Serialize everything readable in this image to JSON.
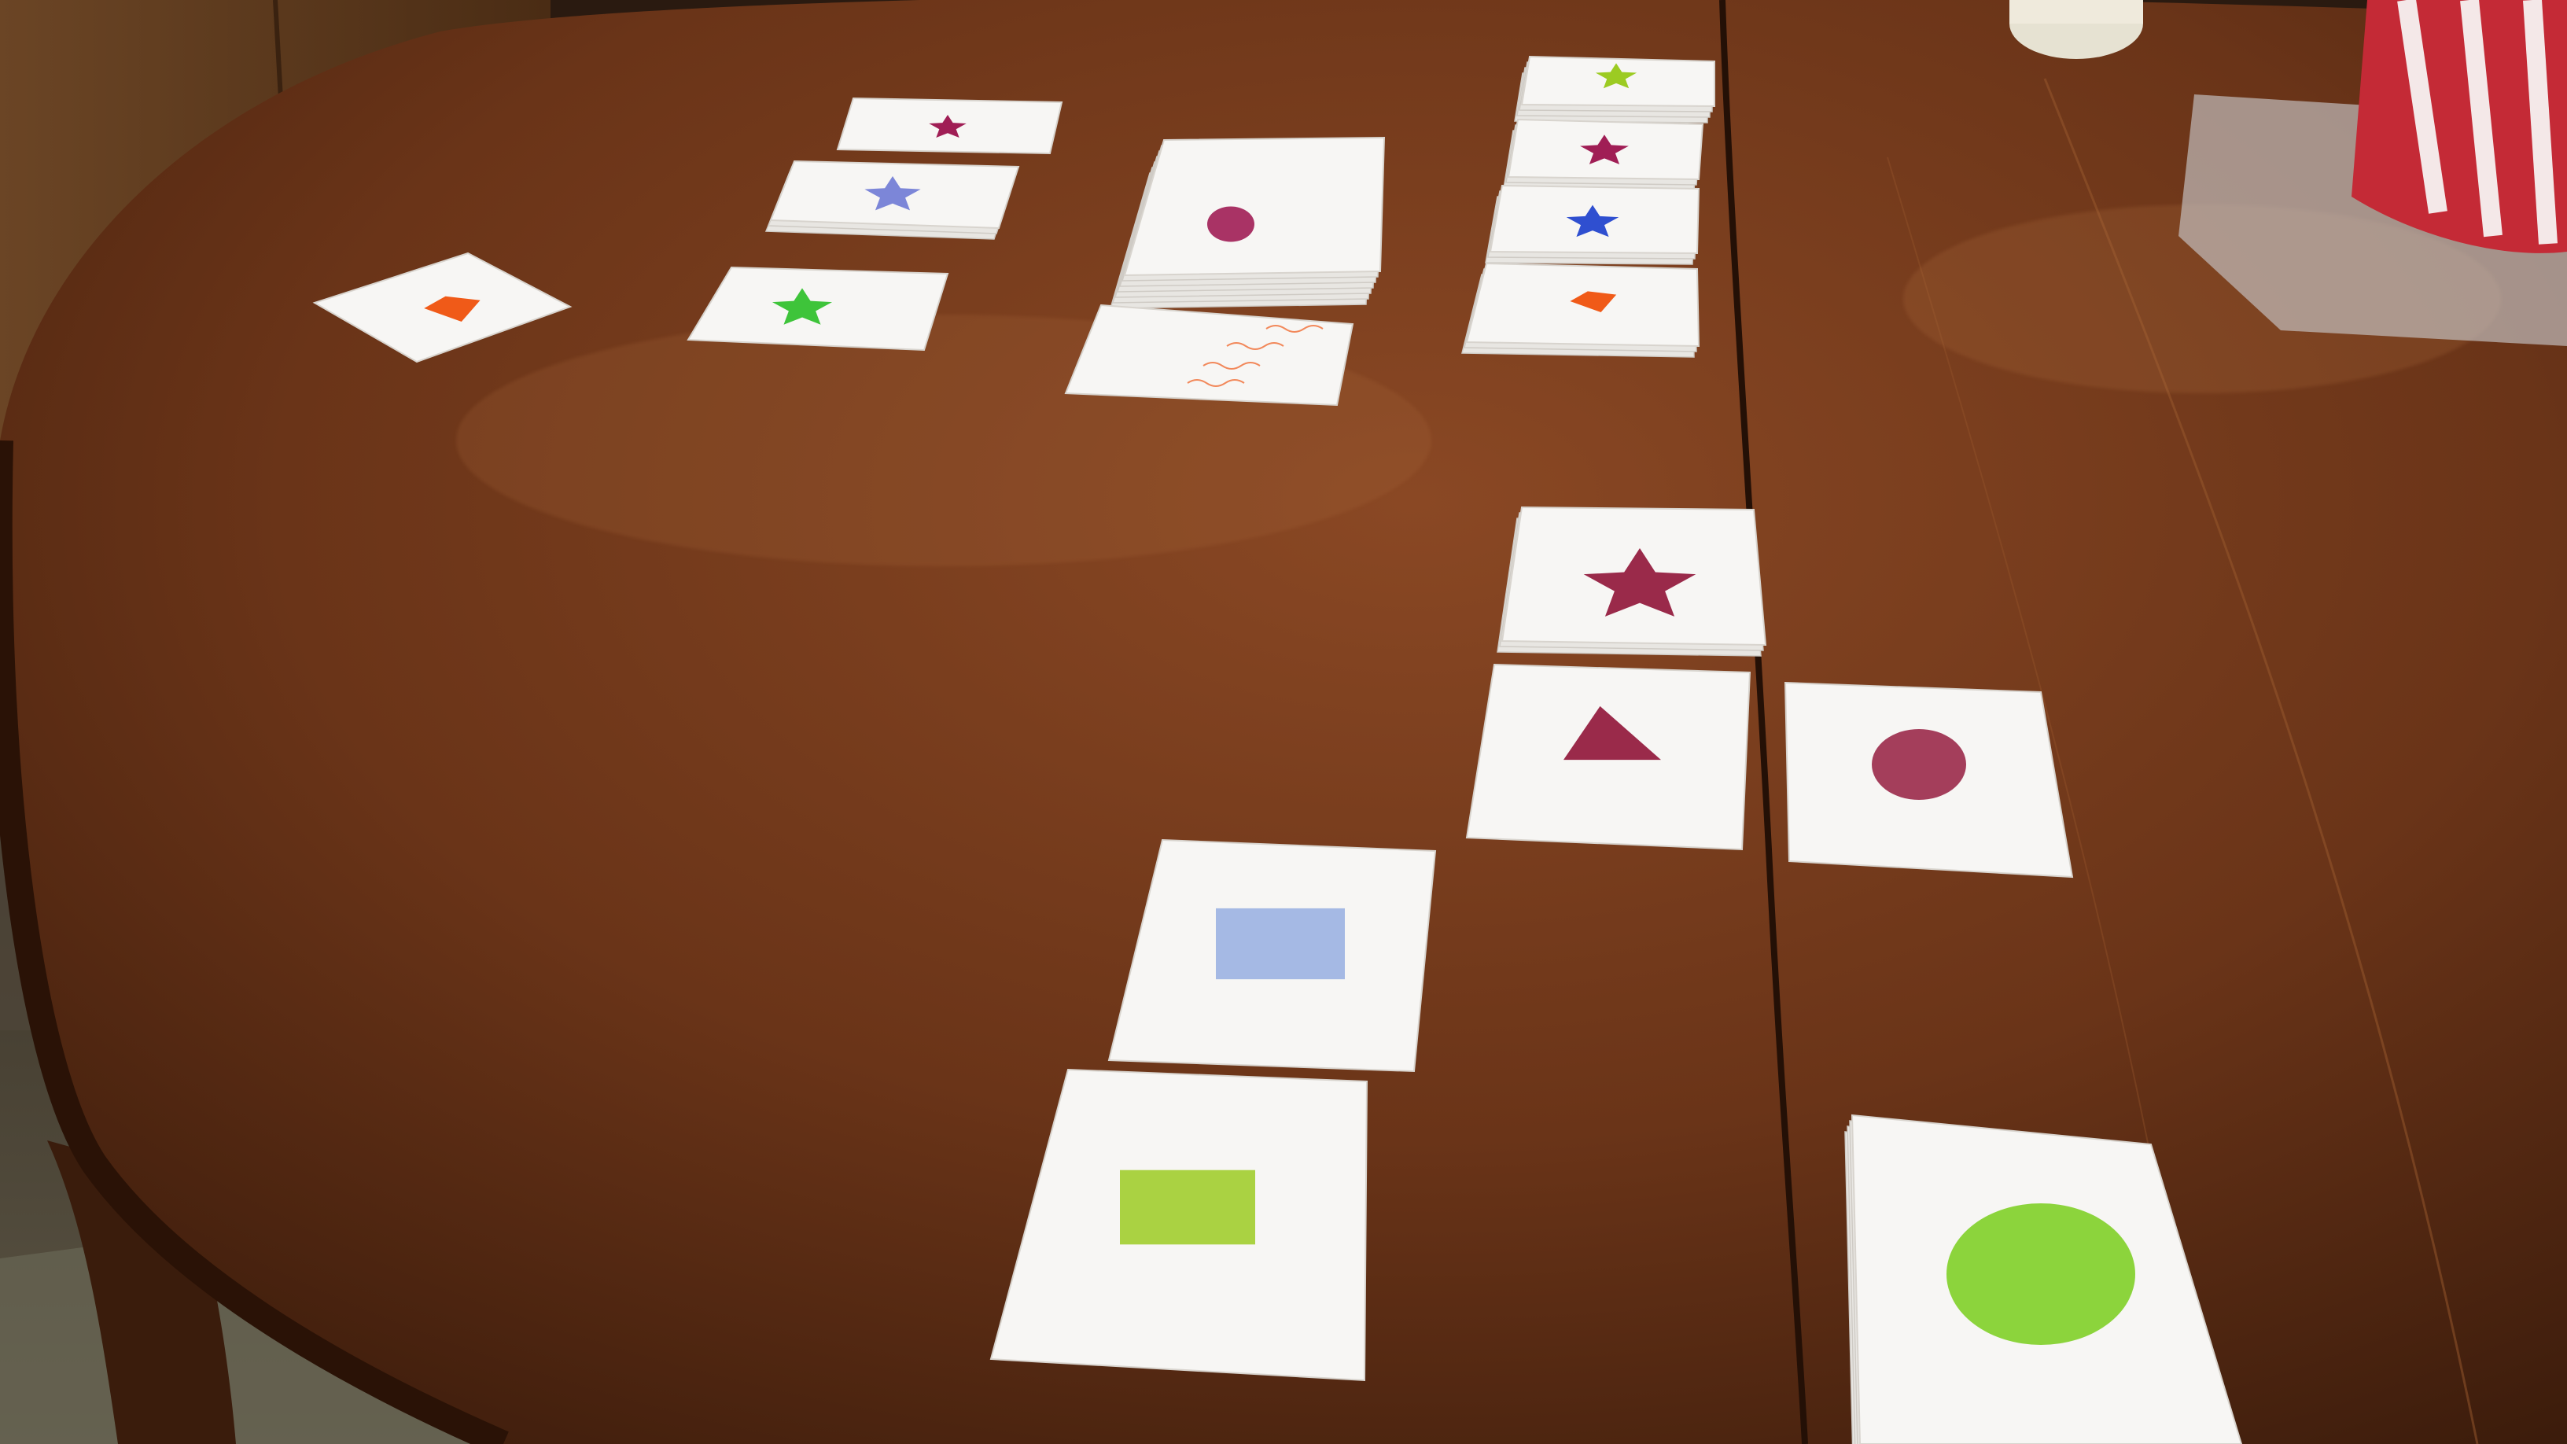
{
  "scene": {
    "description_visible_text": [],
    "colors": {
      "table": "#6e3a1c",
      "table_dark": "#3f1f0e",
      "table_light": "#8a4b25",
      "card": "#f7f6f4",
      "red_violet": "#a01e55",
      "blue_violet": "#7c86d8",
      "royal_blue": "#2f4fd0",
      "orange": "#f05a18",
      "green": "#3ec43a",
      "yellow_green": "#9ccb22",
      "light_blue": "#96aee0",
      "maroon": "#9a2a4a",
      "lime": "#7fd028"
    },
    "cards": [
      {
        "name": "card-orange-diamond",
        "shape": "diamond",
        "color": "orange"
      },
      {
        "name": "card-red-star-small",
        "shape": "star",
        "color": "red_violet"
      },
      {
        "name": "card-blue-star-stack",
        "shape": "star",
        "color": "blue_violet"
      },
      {
        "name": "card-green-star",
        "shape": "star",
        "color": "green"
      },
      {
        "name": "card-deck-circle",
        "shape": "circle",
        "color": "red_violet"
      },
      {
        "name": "card-handwritten-note",
        "shape": "text",
        "color": "orange"
      },
      {
        "name": "card-yellowgreen-star",
        "shape": "star",
        "color": "yellow_green"
      },
      {
        "name": "card-red-star-right",
        "shape": "star",
        "color": "red_violet"
      },
      {
        "name": "card-blue-star-right",
        "shape": "star",
        "color": "royal_blue"
      },
      {
        "name": "card-orange-diamond-right",
        "shape": "diamond",
        "color": "orange"
      },
      {
        "name": "card-maroon-star",
        "shape": "star",
        "color": "maroon"
      },
      {
        "name": "card-maroon-triangle",
        "shape": "triangle",
        "color": "maroon"
      },
      {
        "name": "card-maroon-circle",
        "shape": "circle",
        "color": "maroon"
      },
      {
        "name": "card-lightblue-rectangle",
        "shape": "rectangle",
        "color": "light_blue"
      },
      {
        "name": "card-lime-rectangle",
        "shape": "rectangle",
        "color": "yellow_green"
      },
      {
        "name": "card-lime-circle-stack",
        "shape": "circle",
        "color": "lime"
      }
    ]
  }
}
